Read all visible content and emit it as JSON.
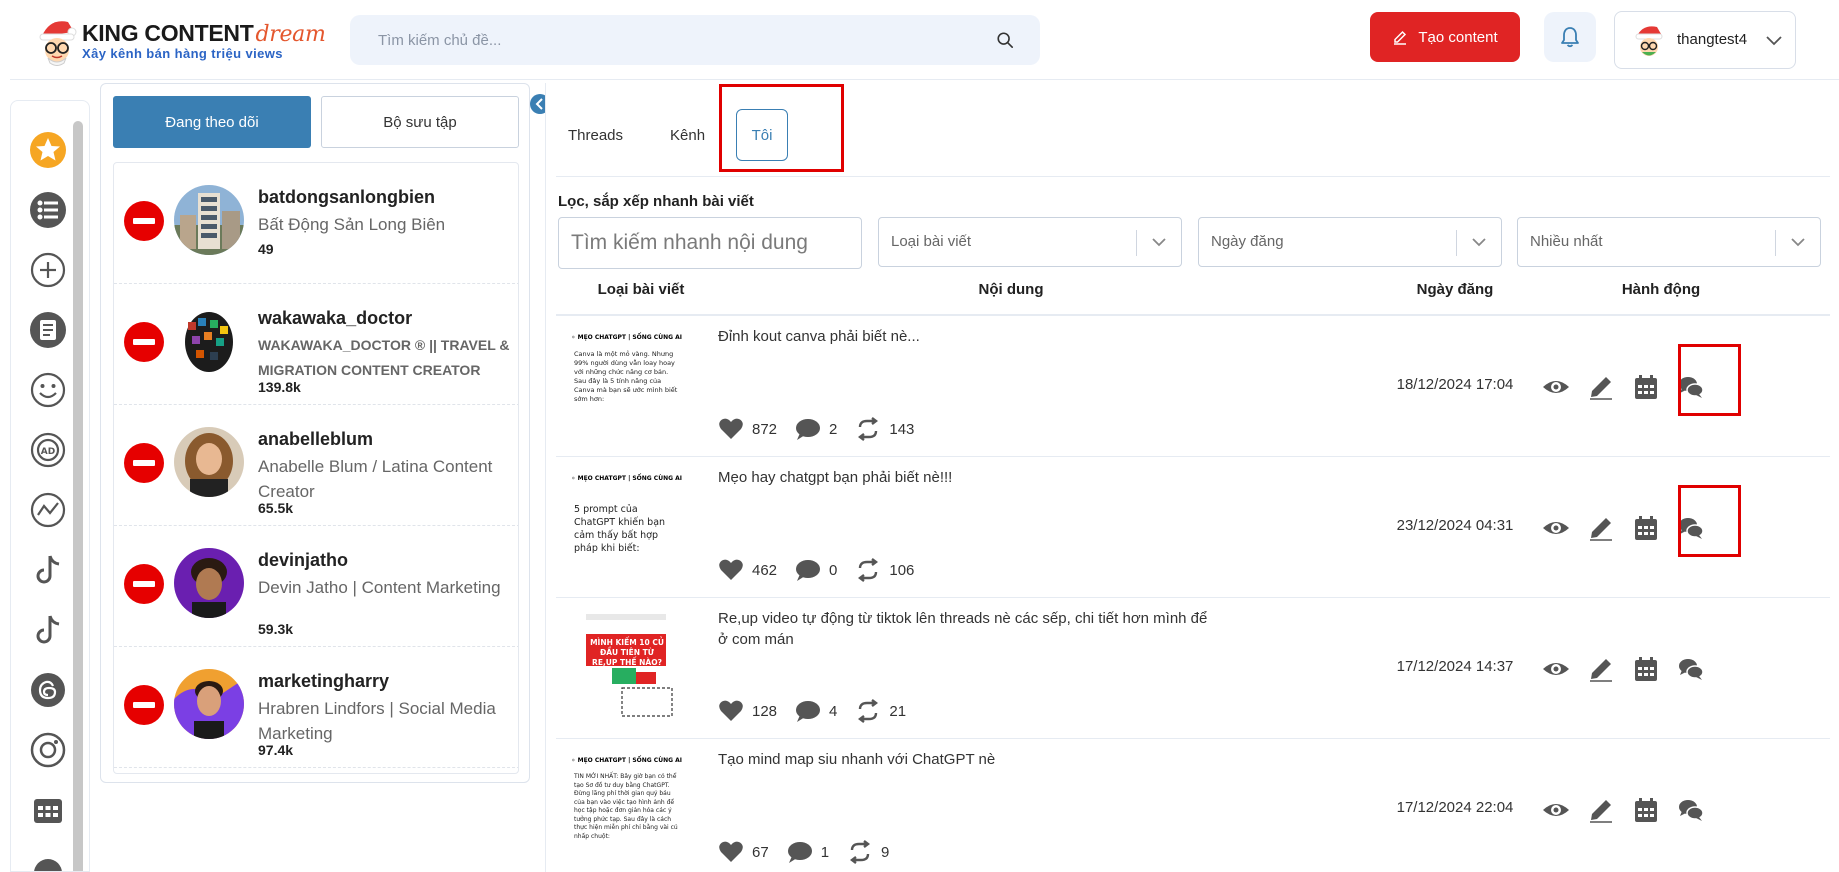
{
  "header": {
    "brand_main": "KING CONTENT",
    "brand_accent": "dream",
    "tagline": "Xây kênh bán hàng triệu views",
    "search_placeholder": "Tìm kiếm chủ đề...",
    "create_label": "Tạo content",
    "username": "thangtest4"
  },
  "follow_panel": {
    "tab_following": "Đang theo dõi",
    "tab_collection": "Bộ sưu tập",
    "items": [
      {
        "handle": "batdongsanlongbien",
        "bio": "Bất Động Sản Long Biên",
        "count": "49"
      },
      {
        "handle": "wakawaka_doctor",
        "bio": "WAKAWAKA_DOCTOR ® || TRAVEL & MIGRATION CONTENT CREATOR",
        "count": "139.8k"
      },
      {
        "handle": "anabelleblum",
        "bio": "Anabelle Blum / Latina Content Creator",
        "count": "65.5k"
      },
      {
        "handle": "devinjatho",
        "bio": "Devin Jatho | Content Marketing",
        "count": "59.3k"
      },
      {
        "handle": "marketingharry",
        "bio": "Hrabren Lindfors | Social Media Marketing",
        "count": "97.4k"
      }
    ]
  },
  "main": {
    "tabs": [
      "Threads",
      "Kênh",
      "Tôi"
    ],
    "active_tab": "Tôi",
    "filter_title": "Lọc, sắp xếp nhanh bài viết",
    "filter_search_placeholder": "Tìm kiếm nhanh nội dung",
    "filter_type": "Loại bài viết",
    "filter_date": "Ngày đăng",
    "filter_sort": "Nhiều nhất",
    "columns": [
      "Loại bài viết",
      "Nội dung",
      "Ngày đăng",
      "Hành động"
    ],
    "posts": [
      {
        "content": "Đỉnh kout canva phải biết nè...",
        "likes": "872",
        "comments": "2",
        "reposts": "143",
        "date": "18/12/2024 17:04",
        "thumb_title": "MẸO CHATGPT | SỐNG CÙNG AI",
        "thumb_body": "Canva là một mỏ vàng. Nhưng 99% người dùng vẫn loay hoay với những chức năng cơ bản. Sau đây là 5 tính năng của Canva mà bạn sẽ ước mình biết sớm hơn:"
      },
      {
        "content": "Mẹo hay chatgpt bạn phải biết nè!!!",
        "likes": "462",
        "comments": "0",
        "reposts": "106",
        "date": "23/12/2024 04:31",
        "thumb_title": "MẸO CHATGPT | SỐNG CÙNG AI",
        "thumb_body": "5 prompt của ChatGPT khiến bạn cảm thấy bất hợp pháp khi biết:"
      },
      {
        "content": "Re,up video tự động từ tiktok lên threads nè các sếp, chi tiết hơn mình để ở com mán",
        "likes": "128",
        "comments": "4",
        "reposts": "21",
        "date": "17/12/2024 14:37",
        "thumb_title": "MÌNH KIẾM 10 CỦ ĐẦU TIÊN TỪ RE,UP THẾ NÀO?",
        "thumb_body": ""
      },
      {
        "content": "Tạo mind map siu nhanh với ChatGPT nè",
        "likes": "67",
        "comments": "1",
        "reposts": "9",
        "date": "17/12/2024 22:04",
        "thumb_title": "MẸO CHATGPT | SỐNG CÙNG AI",
        "thumb_body": "TIN MỚI NHẤT: Bây giờ bạn có thể tạo Sơ đồ tư duy bằng ChatGPT. Đừng lãng phí thời gian quý báu của bạn vào việc tạo hình ảnh để học tập hoặc đơn giản hóa các ý tưởng phức tạp. Sau đây là cách thực hiện miễn phí chỉ bằng vài cú nhấp chuột:"
      }
    ]
  },
  "colors": {
    "primary": "#3a7fb3",
    "danger": "#e02424",
    "highlight": "#e00000",
    "icon_gray": "#555555"
  },
  "icons": [
    "search-icon",
    "pencil-icon",
    "bell-icon",
    "chevron-down-icon",
    "eye-icon",
    "edit-icon",
    "calendar-icon",
    "comments-icon",
    "heart-icon",
    "comment-icon",
    "repost-icon"
  ]
}
